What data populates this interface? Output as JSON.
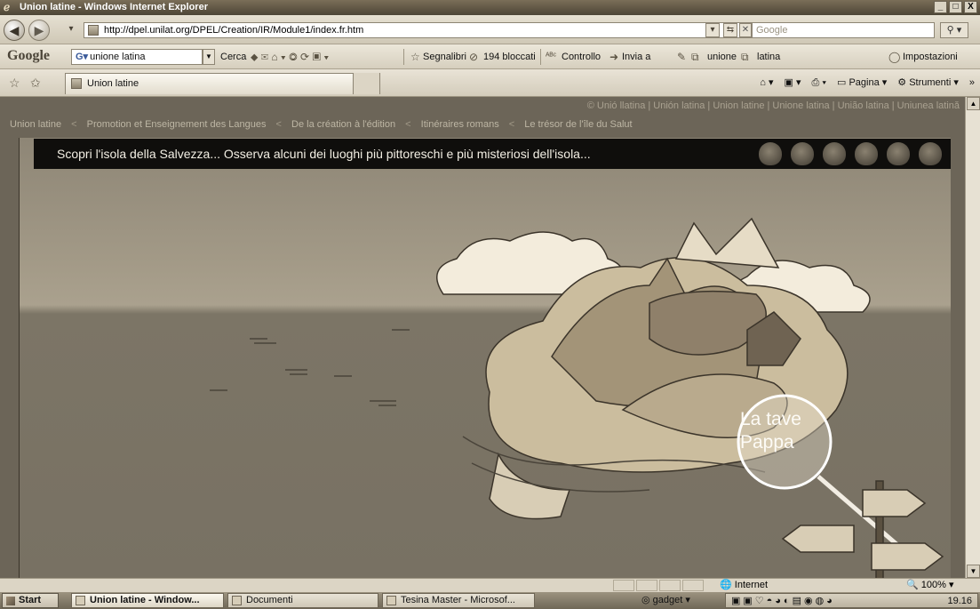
{
  "window": {
    "title": "Union latine - Windows Internet Explorer",
    "controls": [
      "_",
      "□",
      "X"
    ]
  },
  "address": {
    "url": "http://dpel.unilat.org/DPEL/Creation/IR/Module1/index.fr.htm",
    "search_placeholder": "Google"
  },
  "gtoolbar": {
    "logo": "Google",
    "search_value": "unione latina",
    "cerca": "Cerca",
    "segnalibri": "Segnalibri",
    "blocked": "194 bloccati",
    "controllo": "Controllo",
    "invia": "Invia a",
    "unione": "unione",
    "latina": "latina",
    "impostazioni": "Impostazioni"
  },
  "tabs": {
    "active_tab": "Union latine"
  },
  "commandbar": {
    "pagina": "Pagina",
    "strumenti": "Strumenti"
  },
  "page": {
    "credits": "© Unió llatina | Unión latina | Union latine | Unione latina | União latina | Uniunea latină",
    "breadcrumb": [
      "Union latine",
      "Promotion et Enseignement des Langues",
      "De la création à l'édition",
      "Itinéraires romans",
      "Le trésor de l'île du Salut"
    ],
    "caption": "Scopri l'isola della Salvezza...  Osserva alcuni dei luoghi più pittoreschi e più misteriosi dell'isola...",
    "magnifier_text_1": "La tave",
    "magnifier_text_2": "Pappa"
  },
  "status": {
    "zone": "Internet",
    "zoom": "100%"
  },
  "taskbar": {
    "start": "Start",
    "tasks": [
      "Union latine - Window...",
      "Documenti",
      "Tesina Master - Microsof..."
    ],
    "gadget": "gadget",
    "time": "19.16"
  }
}
